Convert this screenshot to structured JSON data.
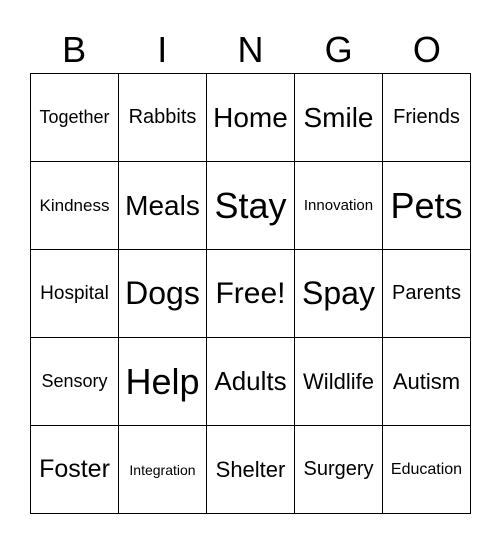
{
  "header": [
    "B",
    "I",
    "N",
    "G",
    "O"
  ],
  "cells": [
    [
      "Together",
      "Rabbits",
      "Home",
      "Smile",
      "Friends"
    ],
    [
      "Kindness",
      "Meals",
      "Stay",
      "Innovation",
      "Pets"
    ],
    [
      "Hospital",
      "Dogs",
      "Free!",
      "Spay",
      "Parents"
    ],
    [
      "Sensory",
      "Help",
      "Adults",
      "Wildlife",
      "Autism"
    ],
    [
      "Foster",
      "Integration",
      "Shelter",
      "Surgery",
      "Education"
    ]
  ]
}
